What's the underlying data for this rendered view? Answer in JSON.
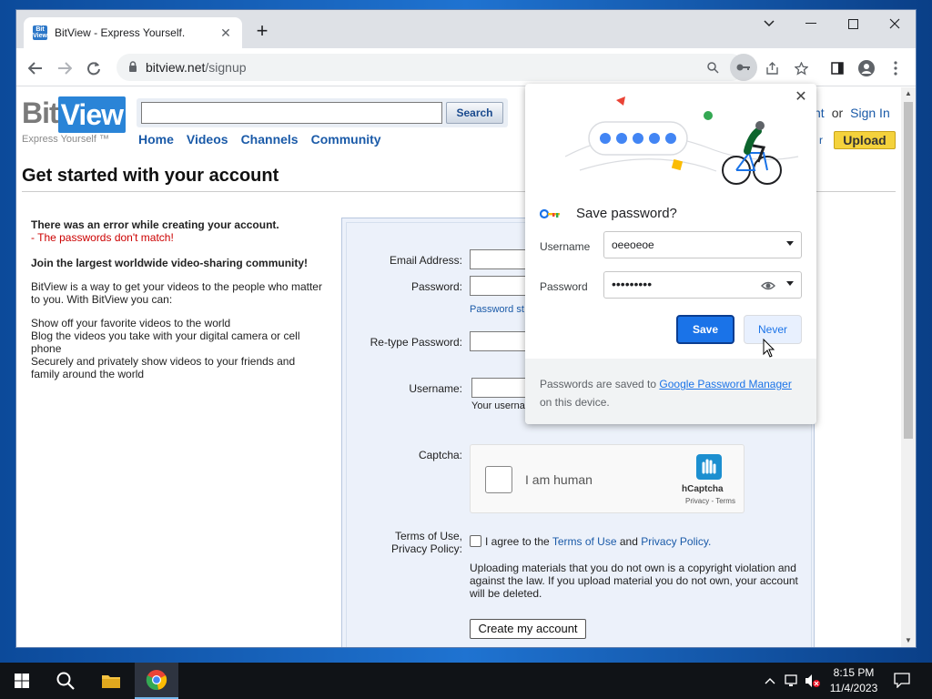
{
  "browser": {
    "tab_title": "BitView - Express Yourself.",
    "tab_favicon": "Bit View",
    "url_host": "bitview.net",
    "url_path": "/signup"
  },
  "site": {
    "logo_bit": "Bit",
    "logo_view": "View",
    "tagline": "Express Yourself ™",
    "search_button": "Search",
    "nav": [
      "Home",
      "Videos",
      "Channels",
      "Community"
    ],
    "account_partial": "nt",
    "or": "or",
    "sign_in": "Sign In",
    "account_menu_partial": "r",
    "upload": "Upload"
  },
  "main": {
    "title": "Get started with your account",
    "error_title": "There was an error while creating your account.",
    "error_message": "- The passwords don't match!",
    "join": "Join the largest worldwide video-sharing community!",
    "intro": "BitView is a way to get your videos to the people who matter to you. With BitView you can:",
    "features": [
      "Show off your favorite videos to the world",
      "Blog the videos you take with your digital camera or cell phone",
      "Securely and privately show videos to your friends and family around the world"
    ]
  },
  "form": {
    "email_label": "Email Address:",
    "password_label": "Password:",
    "password_hint": "Password st",
    "retype_label": "Re-type Password:",
    "username_label": "Username:",
    "username_hint": "Your userna",
    "captcha_label": "Captcha:",
    "captcha_text": "I am human",
    "captcha_brand": "hCaptcha",
    "captcha_links": "Privacy - Terms",
    "terms_label_1": "Terms of Use,",
    "terms_label_2": "Privacy Policy:",
    "terms_agree": "I agree to the ",
    "terms_link": "Terms of Use",
    "terms_and": " and ",
    "privacy_link": "Privacy Policy.",
    "warning": "Uploading materials that you do not own is a copyright violation and against the law. If you upload material you do not own, your account will be deleted.",
    "create_button": "Create my account"
  },
  "password_popup": {
    "title": "Save password?",
    "username_label": "Username",
    "username_value": "oeeoeoe",
    "password_label": "Password",
    "password_value": "•••••••••",
    "save": "Save",
    "never": "Never",
    "footer_pre": "Passwords are saved to ",
    "footer_link": "Google Password Manager",
    "footer_post": " on this device."
  },
  "taskbar": {
    "time": "8:15 PM",
    "date": "11/4/2023"
  },
  "colors": {
    "link": "#1a5aa8",
    "error": "#cc0000",
    "upload": "#f4d23c",
    "save_button": "#1a73e8"
  }
}
